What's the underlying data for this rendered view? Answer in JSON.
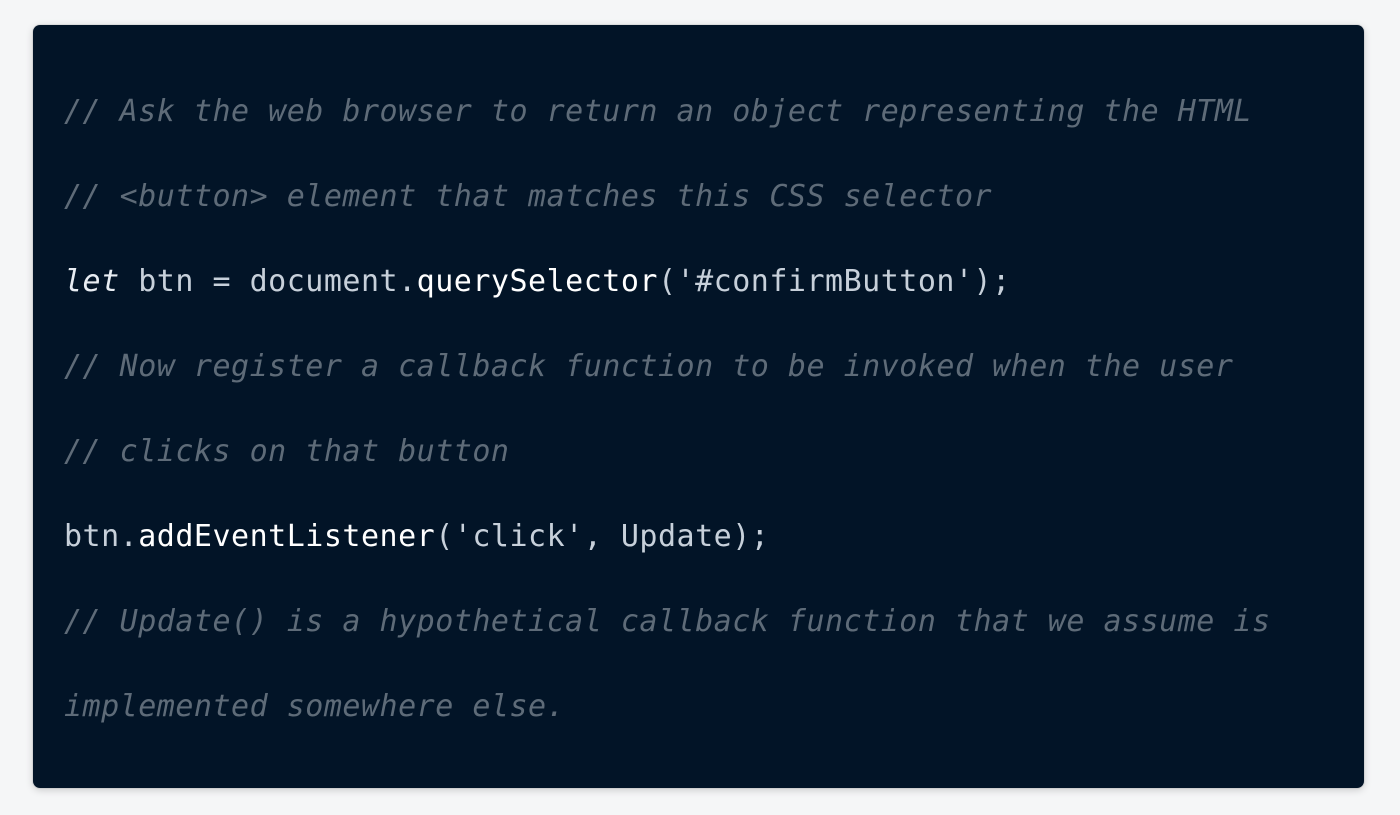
{
  "code": {
    "line1": "// Ask the web browser to return an object representing the HTML",
    "line2": "// <button> element that matches this CSS selector",
    "line3": {
      "keyword": "let",
      "before_method": " btn = document.",
      "method": "querySelector",
      "after_method": "('#confirmButton');"
    },
    "line4": "// Now register a callback function to be invoked when the user",
    "line5": "// clicks on that button",
    "line6": {
      "before_method": "btn.",
      "method": "addEventListener",
      "after_method": "('click', Update);"
    },
    "line7": "// Update() is a hypothetical callback function that we assume is",
    "line8": "implemented somewhere else."
  },
  "colors": {
    "background": "#021427",
    "comment": "#5e6b78",
    "code": "#c7d0da",
    "method": "#ffffff"
  }
}
